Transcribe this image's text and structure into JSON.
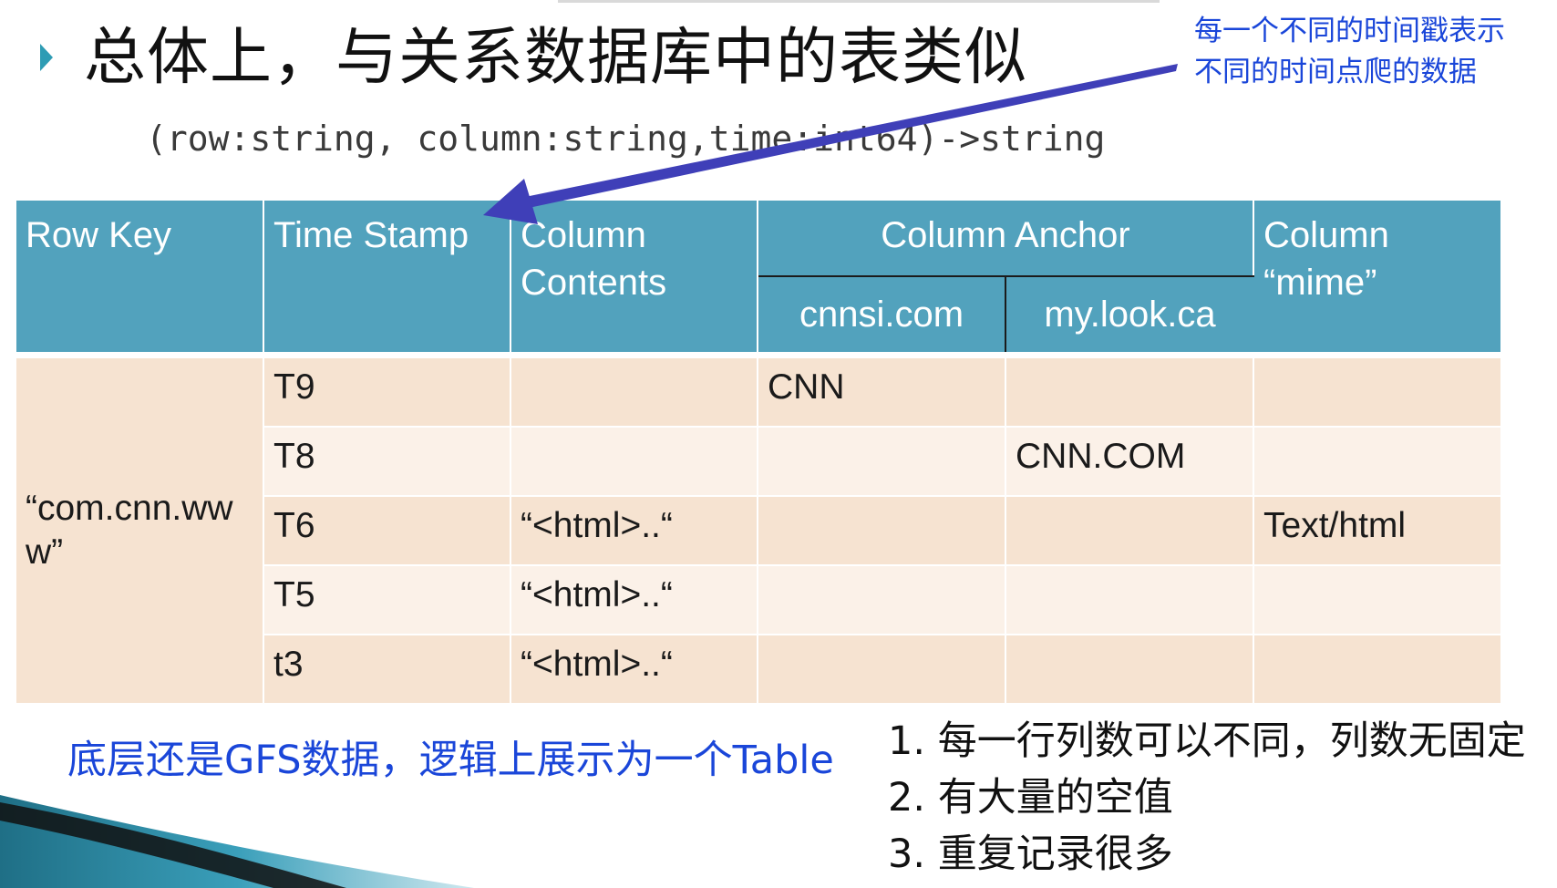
{
  "slide": {
    "title": "总体上，与关系数据库中的表类似",
    "signature": "(row:string, column:string,time:int64)->string",
    "note_line1": "每一个不同的时间戳表示",
    "note_line2": "不同的时间点爬的数据",
    "footer_left": "底层还是GFS数据，逻辑上展示为一个Table",
    "points": [
      "1. 每一行列数可以不同，列数无固定",
      "2. 有大量的空值",
      "3. 重复记录很多"
    ]
  },
  "table": {
    "headers": {
      "row_key": "Row Key",
      "time_stamp": "Time Stamp",
      "column_contents": "Column Contents",
      "column_anchor": "Column Anchor",
      "anchor_sub1": "cnnsi.com",
      "anchor_sub2": "my.look.ca",
      "column_mime": "Column “mime”"
    },
    "row_key_value": "“com.cnn.www”",
    "rows": [
      {
        "ts": "T9",
        "contents": "",
        "anchor1": "CNN",
        "anchor2": "",
        "mime": ""
      },
      {
        "ts": "T8",
        "contents": "",
        "anchor1": "",
        "anchor2": "CNN.COM",
        "mime": ""
      },
      {
        "ts": "T6",
        "contents": "“<html>..“",
        "anchor1": "",
        "anchor2": "",
        "mime": "Text/html"
      },
      {
        "ts": "T5",
        "contents": "“<html>..“",
        "anchor1": "",
        "anchor2": "",
        "mime": ""
      },
      {
        "ts": "t3",
        "contents": "“<html>..“",
        "anchor1": "",
        "anchor2": "",
        "mime": ""
      }
    ]
  },
  "colors": {
    "header": "#52a2bd",
    "row_dark": "#f6e3d1",
    "row_light": "#fbf1e8",
    "annotation": "#1a46d9",
    "arrow": "#3f3fb8"
  }
}
